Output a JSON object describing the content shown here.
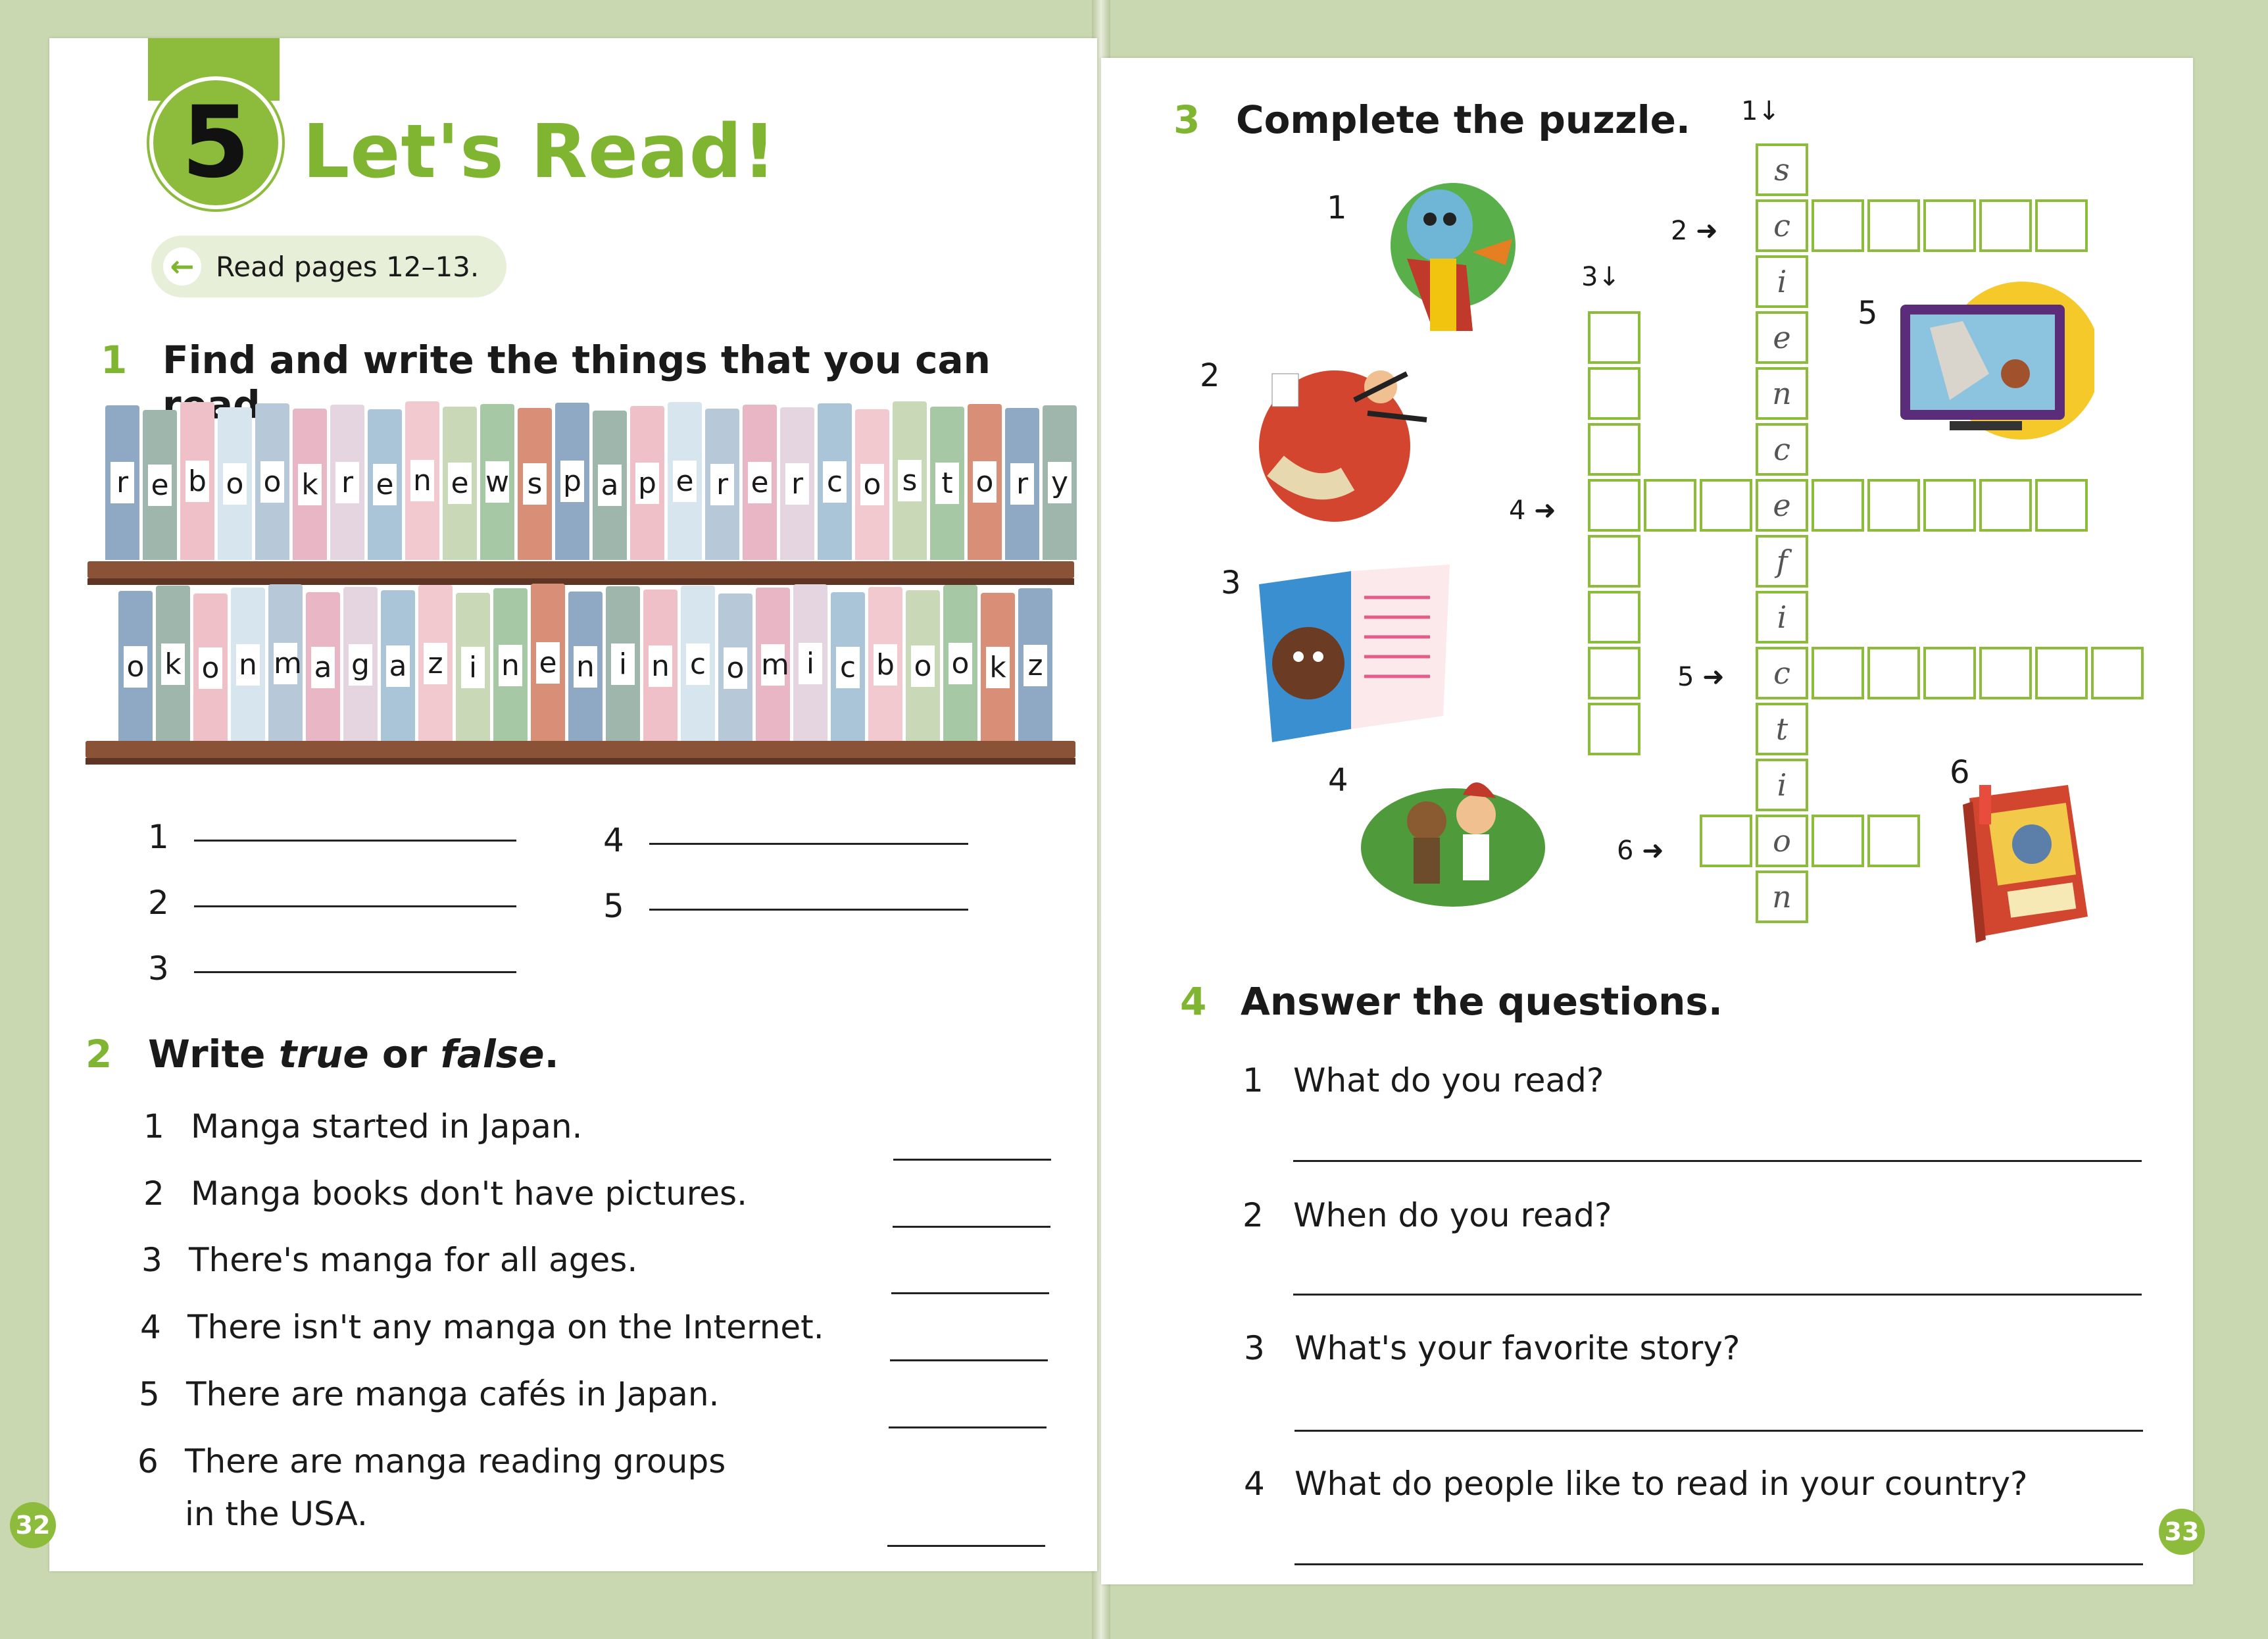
{
  "left": {
    "unit_number": "5",
    "unit_title": "Let's Read!",
    "read_pages": "Read pages 12–13.",
    "ex1": {
      "num": "1",
      "title": "Find and write the things that you can read.",
      "shelf1": [
        "r",
        "e",
        "b",
        "o",
        "o",
        "k",
        "r",
        "e",
        "n",
        "e",
        "w",
        "s",
        "p",
        "a",
        "p",
        "e",
        "r",
        "e",
        "r",
        "c",
        "o",
        "s",
        "t",
        "o",
        "r",
        "y"
      ],
      "shelf2": [
        "o",
        "k",
        "o",
        "n",
        "m",
        "a",
        "g",
        "a",
        "z",
        "i",
        "n",
        "e",
        "n",
        "i",
        "n",
        "c",
        "o",
        "m",
        "i",
        "c",
        "b",
        "o",
        "o",
        "k",
        "z"
      ],
      "answers": [
        "1",
        "2",
        "3",
        "4",
        "5"
      ]
    },
    "ex2": {
      "num": "2",
      "title_a": "Write ",
      "title_true": "true",
      "title_b": " or ",
      "title_false": "false",
      "title_c": ".",
      "items": [
        {
          "n": "1",
          "text": "Manga started in Japan."
        },
        {
          "n": "2",
          "text": "Manga books don't have pictures."
        },
        {
          "n": "3",
          "text": "There's manga for all ages."
        },
        {
          "n": "4",
          "text": "There isn't any manga on the Internet."
        },
        {
          "n": "5",
          "text": "There are manga cafés in Japan."
        },
        {
          "n": "6",
          "text": "There are manga reading groups",
          "text2": "in the USA."
        }
      ]
    },
    "page_number": "32"
  },
  "right": {
    "ex3": {
      "num": "3",
      "title": "Complete the puzzle.",
      "clue_labels": [
        "1",
        "2",
        "3",
        "4",
        "5",
        "6"
      ],
      "picture_labels": [
        "1",
        "2",
        "3",
        "4",
        "5",
        "6"
      ],
      "answer_letters": [
        "s",
        "c",
        "i",
        "e",
        "n",
        "c",
        "e",
        "f",
        "i",
        "c",
        "t",
        "i",
        "o",
        "n"
      ]
    },
    "ex4": {
      "num": "4",
      "title": "Answer the questions.",
      "questions": [
        {
          "n": "1",
          "text": "What do you read?"
        },
        {
          "n": "2",
          "text": "When do you read?"
        },
        {
          "n": "3",
          "text": "What's your favorite story?"
        },
        {
          "n": "4",
          "text": "What do people like to read in your country?"
        }
      ]
    },
    "page_number": "33"
  },
  "colors": {
    "accent": "#8dbb3b",
    "shelf": "#8a5237"
  }
}
